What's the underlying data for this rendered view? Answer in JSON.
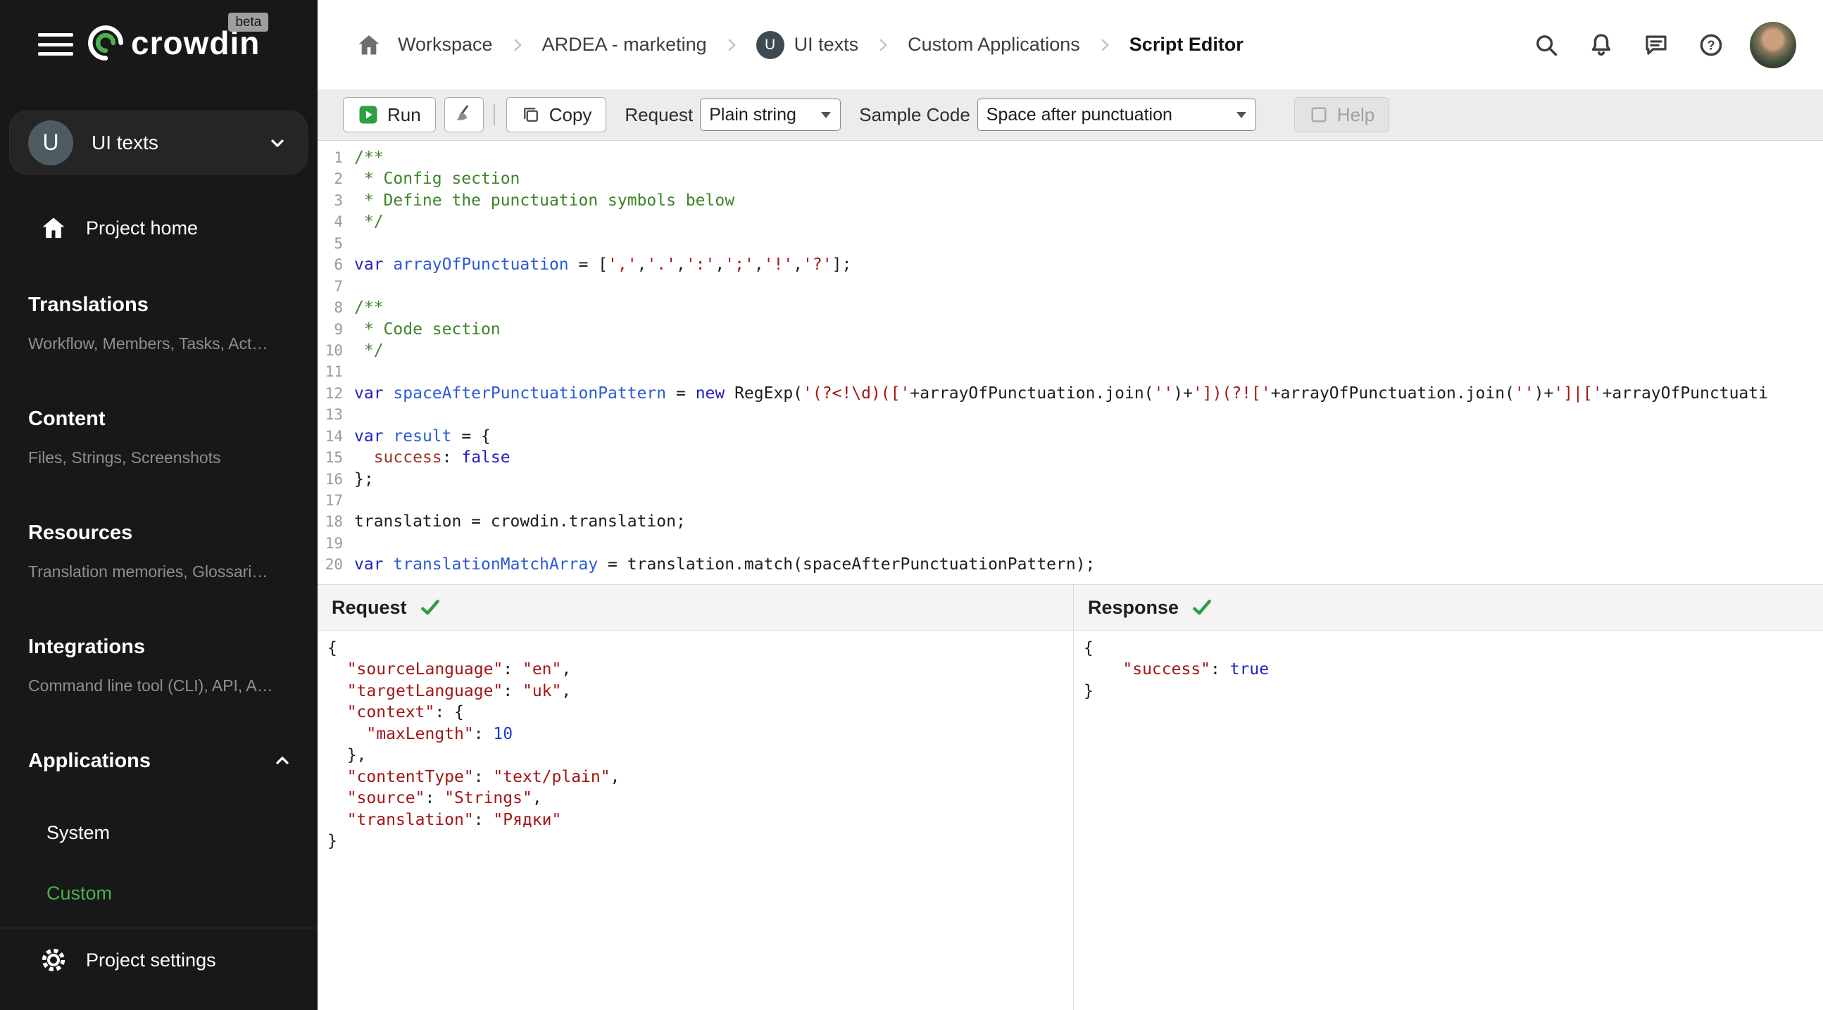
{
  "sidebar": {
    "logo_text": "crowdin",
    "beta_badge": "beta",
    "project": {
      "initial": "U",
      "name": "UI texts"
    },
    "home_label": "Project home",
    "sections": [
      {
        "id": "translations",
        "title": "Translations",
        "subtitle": "Workflow, Members, Tasks, Act…"
      },
      {
        "id": "content",
        "title": "Content",
        "subtitle": "Files, Strings, Screenshots"
      },
      {
        "id": "resources",
        "title": "Resources",
        "subtitle": "Translation memories, Glossari…"
      },
      {
        "id": "integrations",
        "title": "Integrations",
        "subtitle": "Command line tool (CLI), API, A…"
      }
    ],
    "applications": {
      "title": "Applications",
      "items": [
        {
          "id": "system",
          "label": "System",
          "active": false
        },
        {
          "id": "custom",
          "label": "Custom",
          "active": true
        }
      ]
    },
    "settings_label": "Project settings"
  },
  "breadcrumb": {
    "workspace": "Workspace",
    "project": "ARDEA - marketing",
    "app_initial": "U",
    "app": "UI texts",
    "section": "Custom Applications",
    "current": "Script Editor"
  },
  "toolbar": {
    "run_label": "Run",
    "copy_label": "Copy",
    "request_label": "Request",
    "request_value": "Plain string",
    "sample_label": "Sample Code",
    "sample_value": "Space after punctuation",
    "help_label": "Help"
  },
  "editor": {
    "lines": [
      [
        [
          "c",
          "/**"
        ]
      ],
      [
        [
          "c",
          " * Config section"
        ]
      ],
      [
        [
          "c",
          " * Define the punctuation symbols below"
        ]
      ],
      [
        [
          "c",
          " */"
        ]
      ],
      [],
      [
        [
          "k",
          "var"
        ],
        [
          "p",
          " "
        ],
        [
          "v",
          "arrayOfPunctuation"
        ],
        [
          "p",
          " = ["
        ],
        [
          "s",
          "','"
        ],
        [
          "p",
          ","
        ],
        [
          "s",
          "'.'"
        ],
        [
          "p",
          ","
        ],
        [
          "s",
          "':'"
        ],
        [
          "p",
          ","
        ],
        [
          "s",
          "';'"
        ],
        [
          "p",
          ","
        ],
        [
          "s",
          "'!'"
        ],
        [
          "p",
          ","
        ],
        [
          "s",
          "'?'"
        ],
        [
          "p",
          "];"
        ]
      ],
      [],
      [
        [
          "c",
          "/**"
        ]
      ],
      [
        [
          "c",
          " * Code section"
        ]
      ],
      [
        [
          "c",
          " */"
        ]
      ],
      [],
      [
        [
          "k",
          "var"
        ],
        [
          "p",
          " "
        ],
        [
          "v",
          "spaceAfterPunctuationPattern"
        ],
        [
          "p",
          " = "
        ],
        [
          "k",
          "new"
        ],
        [
          "p",
          " RegExp("
        ],
        [
          "s",
          "'(?<!\\d)(['"
        ],
        [
          "p",
          "+arrayOfPunctuation.join("
        ],
        [
          "s",
          "''"
        ],
        [
          "p",
          ")+"
        ],
        [
          "s",
          "'])(?!['"
        ],
        [
          "p",
          "+arrayOfPunctuation.join("
        ],
        [
          "s",
          "''"
        ],
        [
          "p",
          ")+"
        ],
        [
          "s",
          "']|['"
        ],
        [
          "p",
          "+arrayOfPunctuati"
        ]
      ],
      [],
      [
        [
          "k",
          "var"
        ],
        [
          "p",
          " "
        ],
        [
          "v",
          "result"
        ],
        [
          "p",
          " = {"
        ]
      ],
      [
        [
          "p",
          "  "
        ],
        [
          "pr",
          "success"
        ],
        [
          "p",
          ": "
        ],
        [
          "k",
          "false"
        ]
      ],
      [
        [
          "p",
          "};"
        ]
      ],
      [],
      [
        [
          "p",
          "translation = crowdin.translation;"
        ]
      ],
      [],
      [
        [
          "k",
          "var"
        ],
        [
          "p",
          " "
        ],
        [
          "v",
          "translationMatchArray"
        ],
        [
          "p",
          " = translation.match(spaceAfterPunctuationPattern);"
        ]
      ]
    ]
  },
  "panels": {
    "request": {
      "title": "Request",
      "status": "valid",
      "lines": [
        [
          [
            "p",
            "{"
          ]
        ],
        [
          [
            "p",
            "  "
          ],
          [
            "key",
            "\"sourceLanguage\""
          ],
          [
            "p",
            ": "
          ],
          [
            "str",
            "\"en\""
          ],
          [
            "p",
            ","
          ]
        ],
        [
          [
            "p",
            "  "
          ],
          [
            "key",
            "\"targetLanguage\""
          ],
          [
            "p",
            ": "
          ],
          [
            "str",
            "\"uk\""
          ],
          [
            "p",
            ","
          ]
        ],
        [
          [
            "p",
            "  "
          ],
          [
            "key",
            "\"context\""
          ],
          [
            "p",
            ": {"
          ]
        ],
        [
          [
            "p",
            "    "
          ],
          [
            "key",
            "\"maxLength\""
          ],
          [
            "p",
            ": "
          ],
          [
            "num",
            "10"
          ]
        ],
        [
          [
            "p",
            "  },"
          ]
        ],
        [
          [
            "p",
            "  "
          ],
          [
            "key",
            "\"contentType\""
          ],
          [
            "p",
            ": "
          ],
          [
            "str",
            "\"text/plain\""
          ],
          [
            "p",
            ","
          ]
        ],
        [
          [
            "p",
            "  "
          ],
          [
            "key",
            "\"source\""
          ],
          [
            "p",
            ": "
          ],
          [
            "str",
            "\"Strings\""
          ],
          [
            "p",
            ","
          ]
        ],
        [
          [
            "p",
            "  "
          ],
          [
            "key",
            "\"translation\""
          ],
          [
            "p",
            ": "
          ],
          [
            "str",
            "\"Рядки\""
          ]
        ],
        [
          [
            "p",
            "}"
          ]
        ]
      ]
    },
    "response": {
      "title": "Response",
      "status": "valid",
      "lines": [
        [
          [
            "p",
            "{"
          ]
        ],
        [
          [
            "p",
            "    "
          ],
          [
            "key",
            "\"success\""
          ],
          [
            "p",
            ": "
          ],
          [
            "bool",
            "true"
          ]
        ],
        [
          [
            "p",
            "}"
          ]
        ]
      ]
    }
  },
  "colors": {
    "accent_green": "#4caf50",
    "check_green": "#2f9e44",
    "string_red": "#a31515",
    "keyword_blue": "#1f1fc4",
    "sidebar_bg": "#181818"
  }
}
